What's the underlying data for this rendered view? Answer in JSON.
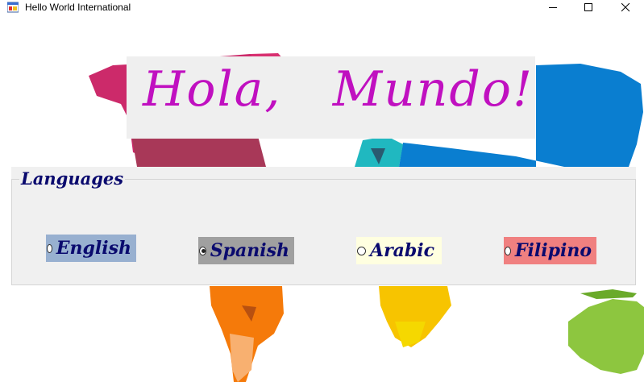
{
  "window": {
    "title": "Hello World International",
    "icon": "winforms-app-icon",
    "controls": [
      "minimize-icon",
      "maximize-icon",
      "close-icon"
    ]
  },
  "greeting": {
    "text": "Hola,   Mundo!",
    "color": "#c010c0"
  },
  "languages": {
    "title": "Languages",
    "options": [
      {
        "label": "English",
        "checked": false,
        "background": "#98b0d0"
      },
      {
        "label": "Spanish",
        "checked": true,
        "background": "#a0a0a0"
      },
      {
        "label": "Arabic",
        "checked": false,
        "background": "#ffffe0"
      },
      {
        "label": "Filipino",
        "checked": false,
        "background": "#f08080"
      }
    ]
  },
  "background_image": "colorful-world-map"
}
